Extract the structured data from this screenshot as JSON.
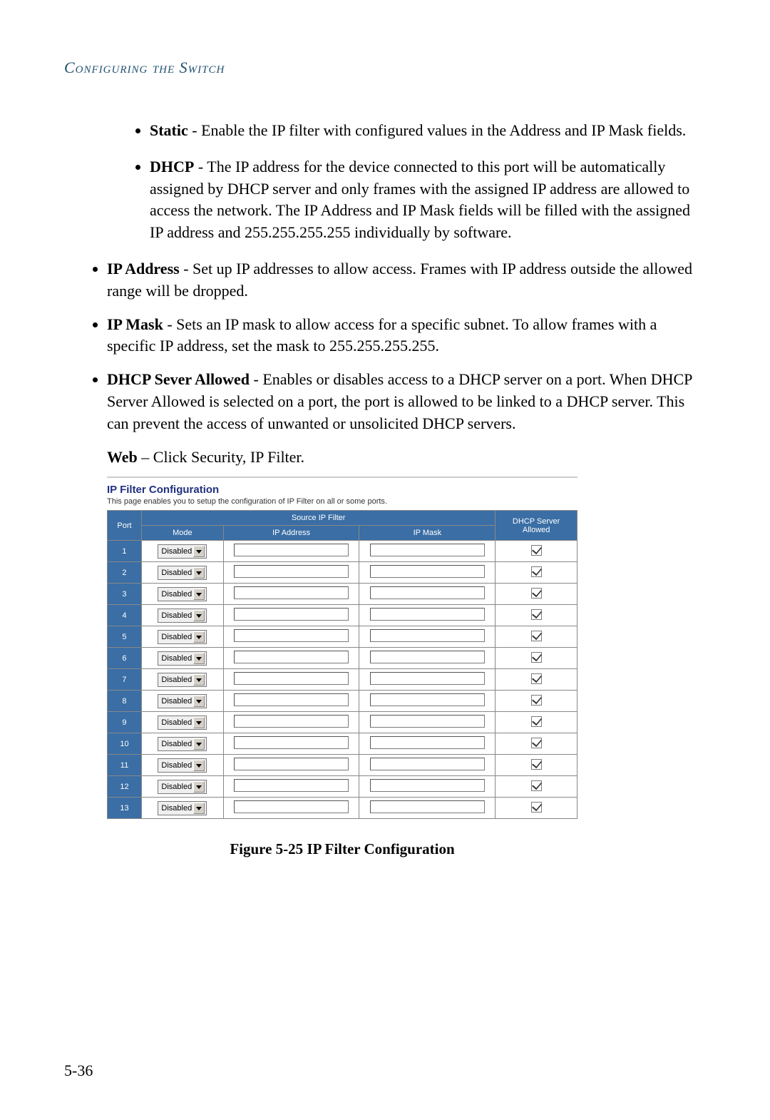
{
  "section_header": "Configuring the Switch",
  "bullets_inner": [
    {
      "term": "Static",
      "text": " - Enable the IP filter with configured values in the Address and IP Mask fields."
    },
    {
      "term": "DHCP",
      "text": " - The IP address for the device connected to this port will be automatically assigned by DHCP server and only frames with the assigned IP address are allowed to access the network. The IP Address and IP Mask fields will be filled with the assigned IP address and 255.255.255.255 individually by software."
    }
  ],
  "bullets_outer": [
    {
      "term": "IP Address",
      "text": " - Set up IP addresses to allow access. Frames with IP address outside the allowed range will be dropped."
    },
    {
      "term": "IP Mask",
      "text": " - Sets an IP mask to allow access for a specific subnet. To allow frames with a specific IP address, set the mask to 255.255.255.255."
    },
    {
      "term": "DHCP Sever Allowed",
      "text": " - Enables or disables access to a DHCP server on a port. When DHCP Server Allowed is selected on a port, the port is allowed to be linked to a DHCP server. This can prevent the access of unwanted or unsolicited DHCP servers."
    }
  ],
  "web_line_bold": "Web",
  "web_line_rest": " – Click Security, IP Filter.",
  "figure": {
    "title": "IP Filter Configuration",
    "subtitle": "This page enables you to setup the configuration of IP Filter on all or some ports.",
    "headers": {
      "port": "Port",
      "source": "Source IP Filter",
      "mode": "Mode",
      "ipaddr": "IP Address",
      "ipmask": "IP Mask",
      "dhcp": "DHCP Server Allowed"
    },
    "rows": [
      {
        "port": "1",
        "mode": "Disabled",
        "ipaddr": "",
        "ipmask": "",
        "allowed": true
      },
      {
        "port": "2",
        "mode": "Disabled",
        "ipaddr": "",
        "ipmask": "",
        "allowed": true
      },
      {
        "port": "3",
        "mode": "Disabled",
        "ipaddr": "",
        "ipmask": "",
        "allowed": true
      },
      {
        "port": "4",
        "mode": "Disabled",
        "ipaddr": "",
        "ipmask": "",
        "allowed": true
      },
      {
        "port": "5",
        "mode": "Disabled",
        "ipaddr": "",
        "ipmask": "",
        "allowed": true
      },
      {
        "port": "6",
        "mode": "Disabled",
        "ipaddr": "",
        "ipmask": "",
        "allowed": true
      },
      {
        "port": "7",
        "mode": "Disabled",
        "ipaddr": "",
        "ipmask": "",
        "allowed": true
      },
      {
        "port": "8",
        "mode": "Disabled",
        "ipaddr": "",
        "ipmask": "",
        "allowed": true
      },
      {
        "port": "9",
        "mode": "Disabled",
        "ipaddr": "",
        "ipmask": "",
        "allowed": true
      },
      {
        "port": "10",
        "mode": "Disabled",
        "ipaddr": "",
        "ipmask": "",
        "allowed": true
      },
      {
        "port": "11",
        "mode": "Disabled",
        "ipaddr": "",
        "ipmask": "",
        "allowed": true
      },
      {
        "port": "12",
        "mode": "Disabled",
        "ipaddr": "",
        "ipmask": "",
        "allowed": true
      },
      {
        "port": "13",
        "mode": "Disabled",
        "ipaddr": "",
        "ipmask": "",
        "allowed": true
      }
    ]
  },
  "figure_caption": "Figure 5-25  IP Filter Configuration",
  "page_number": "5-36"
}
